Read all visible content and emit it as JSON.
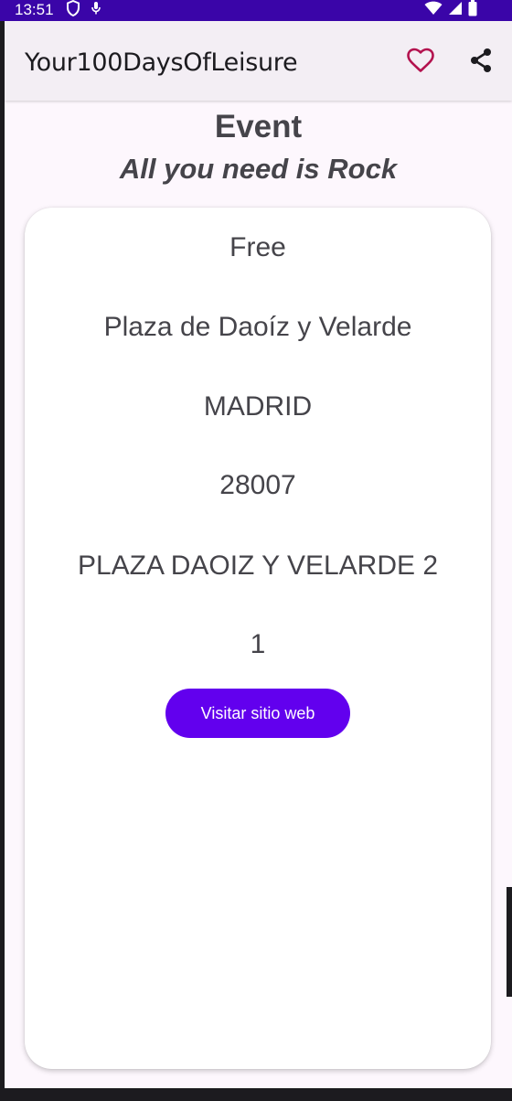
{
  "status_bar": {
    "time": "13:51",
    "left_icons": [
      "shield-icon",
      "microphone-icon"
    ],
    "right_icons": [
      "wifi-icon",
      "signal-icon",
      "battery-icon"
    ],
    "background": "#3a05a8"
  },
  "app_bar": {
    "title": "Your100DaysOfLeisure",
    "actions": [
      {
        "icon": "heart-outline-icon",
        "color": "#b3124e"
      },
      {
        "icon": "share-icon",
        "color": "#1c1b1f"
      }
    ]
  },
  "event": {
    "heading": "Event",
    "title": "All you need is Rock"
  },
  "details": {
    "price": "Free",
    "venue": "Plaza de Daoíz y Velarde",
    "city": "MADRID",
    "postal_code": "28007",
    "street": "PLAZA DAOIZ Y VELARDE 2",
    "number": "1"
  },
  "actions": {
    "website_button_label": "Visitar sitio web",
    "accent": "#6200ee"
  }
}
